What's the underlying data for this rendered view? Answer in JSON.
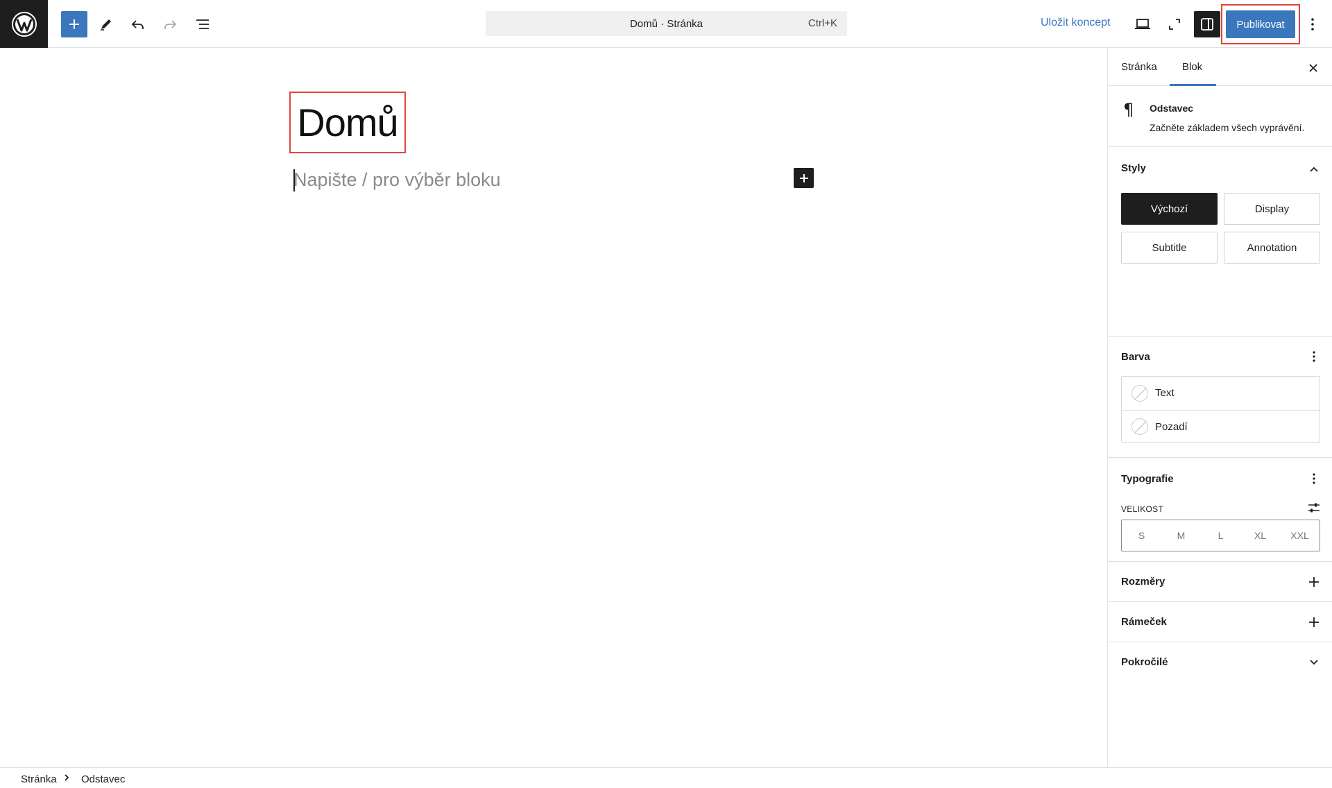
{
  "toolbar": {
    "command_title": "Domů · Stránka",
    "command_shortcut": "Ctrl+K",
    "save_draft": "Uložit koncept",
    "publish": "Publikovat"
  },
  "editor": {
    "title": "Domů",
    "paragraph_placeholder": "Napište / pro výběr bloku"
  },
  "sidebar": {
    "tabs": [
      {
        "label": "Stránka"
      },
      {
        "label": "Blok"
      }
    ],
    "block": {
      "name": "Odstavec",
      "description": "Začněte základem všech vyprávění."
    },
    "styles": {
      "title": "Styly",
      "options": [
        {
          "label": "Výchozí"
        },
        {
          "label": "Display"
        },
        {
          "label": "Subtitle"
        },
        {
          "label": "Annotation"
        }
      ]
    },
    "color": {
      "title": "Barva",
      "items": [
        {
          "label": "Text"
        },
        {
          "label": "Pozadí"
        }
      ]
    },
    "typography": {
      "title": "Typografie",
      "size_label": "VELIKOST",
      "sizes": [
        "S",
        "M",
        "L",
        "XL",
        "XXL"
      ]
    },
    "dimensions": {
      "title": "Rozměry"
    },
    "border": {
      "title": "Rámeček"
    },
    "advanced": {
      "title": "Pokročilé"
    }
  },
  "breadcrumb": {
    "items": [
      {
        "label": "Stránka"
      },
      {
        "label": "Odstavec"
      }
    ]
  },
  "colors": {
    "accent": "#3a77bd",
    "highlight": "#e0463c",
    "dark": "#1e1e1e"
  },
  "icons": {
    "logo": "wordpress-logo-icon",
    "add": "plus-icon",
    "tools": "pencil-icon",
    "undo": "undo-icon",
    "redo": "redo-icon",
    "outline": "list-view-icon",
    "view": "laptop-icon",
    "fullscreen": "expand-icon",
    "settings": "sidebar-toggle-icon",
    "options": "vertical-ellipsis-icon"
  }
}
